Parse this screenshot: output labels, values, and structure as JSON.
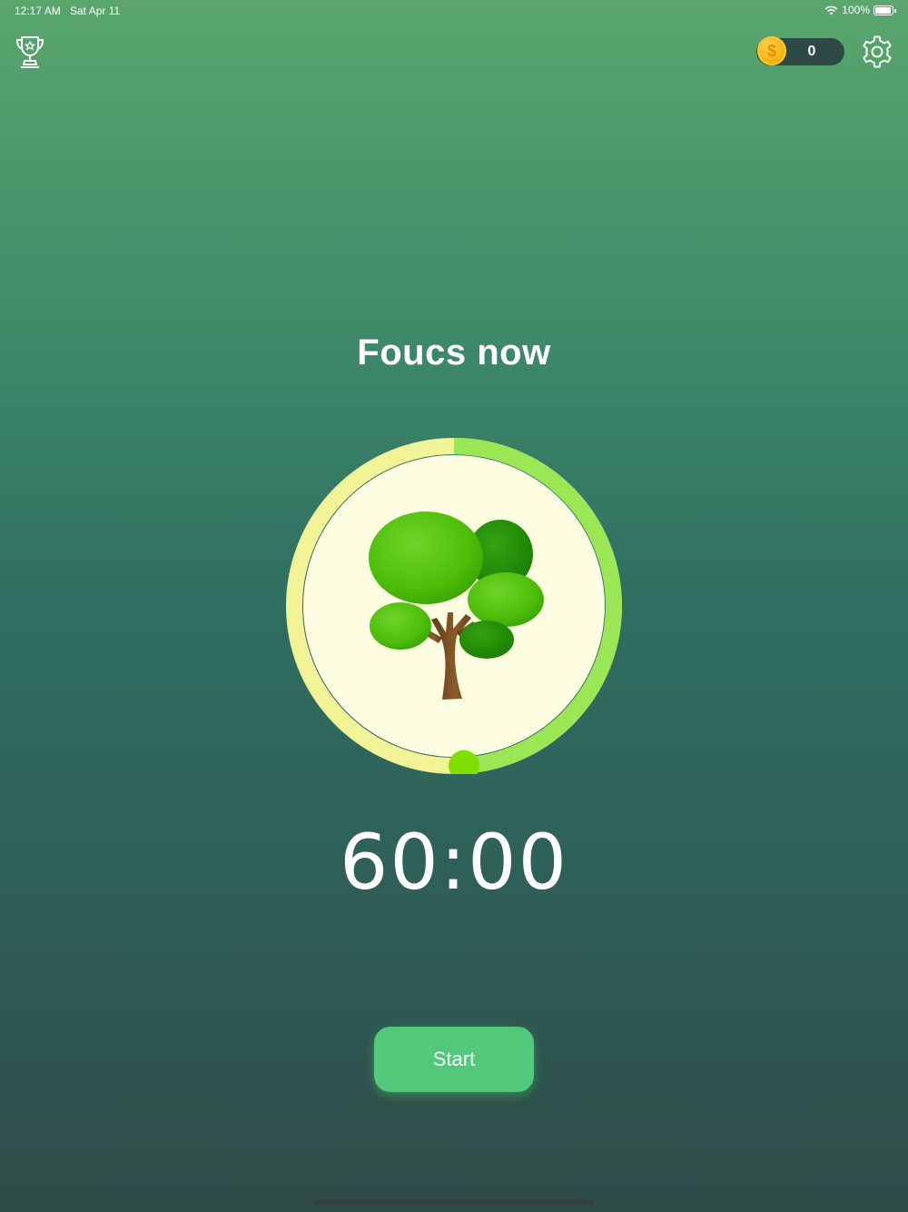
{
  "status_bar": {
    "time": "12:17 AM",
    "date": "Sat Apr 11",
    "battery": "100%",
    "battery_level": 1.0
  },
  "header": {
    "coin_count": "0",
    "coin_symbol": "$"
  },
  "main": {
    "title": "Foucs now",
    "timer": "60:00",
    "progress": 0.49
  },
  "actions": {
    "start_label": "Start"
  },
  "colors": {
    "accent_green": "#52c87a",
    "ring_progress": "#9ae655",
    "ring_track": "#f2f296",
    "knob": "#7fe000",
    "inner_disc": "#fdfde2"
  },
  "icons": [
    "trophy-icon",
    "coin-icon",
    "gear-icon",
    "tree-icon",
    "wifi-icon",
    "battery-icon"
  ]
}
